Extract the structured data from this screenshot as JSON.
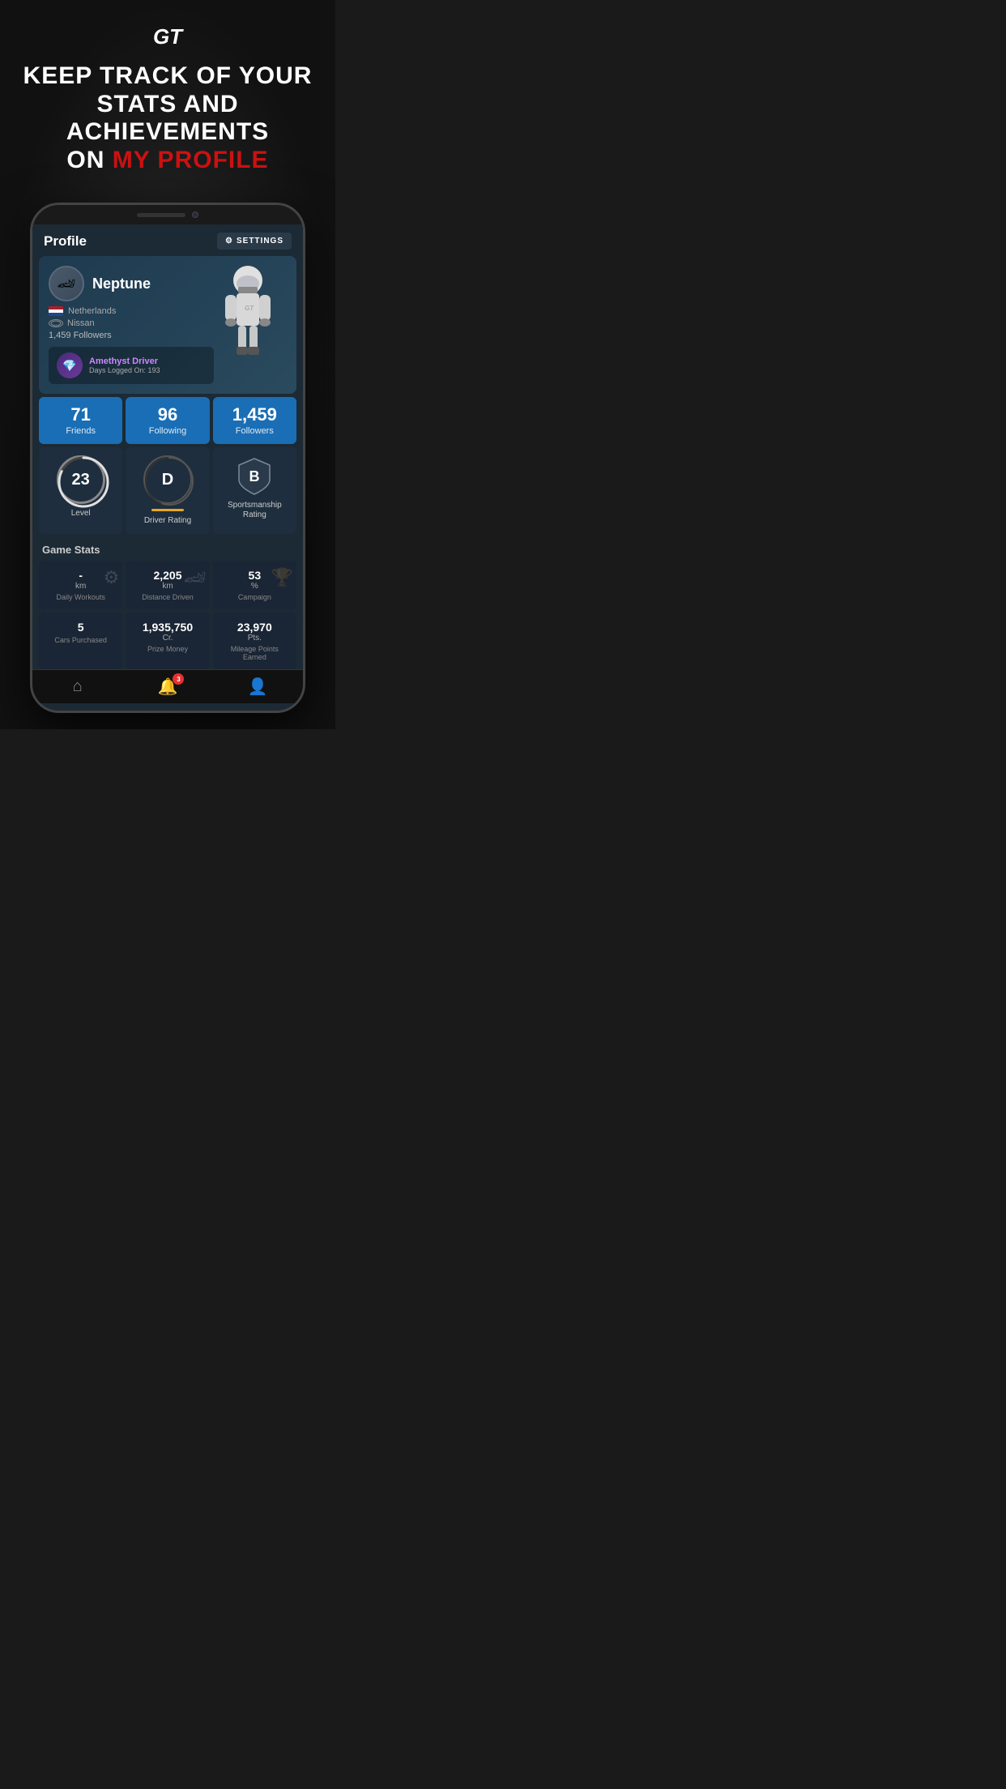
{
  "app": {
    "logo": "GT",
    "promo": {
      "line1": "KEEP TRACK OF YOUR",
      "line2": "STATS AND ACHIEVEMENTS",
      "line3_normal": "ON ",
      "line3_highlight": "MY PROFILE"
    }
  },
  "profile": {
    "title": "Profile",
    "settings_label": "SETTINGS",
    "user": {
      "name": "Neptune",
      "country": "Netherlands",
      "car_brand": "Nissan",
      "followers_text": "1,459 Followers",
      "driver_class": "Amethyst Driver",
      "days_logged": "Days Logged On: 193"
    },
    "quick_stats": [
      {
        "value": "71",
        "label": "Friends"
      },
      {
        "value": "96",
        "label": "Following"
      },
      {
        "value": "1,459",
        "label": "Followers"
      }
    ],
    "ratings": {
      "level": {
        "value": "23",
        "label": "Level"
      },
      "driver_rating": {
        "value": "D",
        "label": "Driver Rating"
      },
      "sportsmanship": {
        "label": "Sportsmanship Rating",
        "value": "B"
      }
    },
    "game_stats_title": "Game Stats",
    "game_stats": [
      {
        "value": "-",
        "unit": "km",
        "label": "Daily Workouts"
      },
      {
        "value": "2,205",
        "unit": "km",
        "label": "Distance Driven"
      },
      {
        "value": "53",
        "unit": "%",
        "label": "Campaign"
      },
      {
        "value": "5",
        "unit": "",
        "label": "Cars Purchased"
      },
      {
        "value": "1,935,750",
        "unit": "Cr.",
        "label": "Prize Money"
      },
      {
        "value": "23,970",
        "unit": "Pts.",
        "label": "Mileage Points Earned"
      }
    ]
  },
  "navigation": [
    {
      "icon": "🏠",
      "label": "home",
      "active": false
    },
    {
      "icon": "🔔",
      "label": "notifications",
      "badge": "3",
      "active": false
    },
    {
      "icon": "👤",
      "label": "profile",
      "active": true
    }
  ],
  "colors": {
    "accent_blue": "#1a6eb5",
    "highlight_red": "#cc1111",
    "card_bg": "#1e2e3e",
    "app_bg": "#1c2a35"
  }
}
